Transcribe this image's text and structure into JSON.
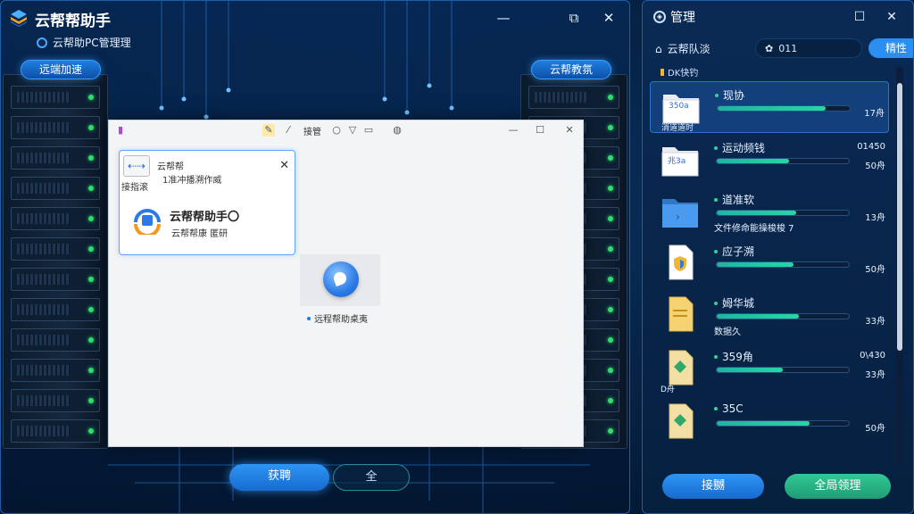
{
  "app": {
    "title": "云帮帮助手",
    "subtitle": "云帮助PC管理理"
  },
  "window_controls": {
    "minimize": "—",
    "restore": "⧉",
    "close": "✕"
  },
  "pills": {
    "left": "远端加速",
    "right": "云帮教氛"
  },
  "inner_window": {
    "toolbar": {
      "label": "接管"
    },
    "controls": {
      "minimize": "—",
      "maximize": "☐",
      "close": "✕"
    },
    "card": {
      "icon_label": "接指滚",
      "title": "云帮帮",
      "desc": "1准冲播溯作威",
      "app_name": "云帮帮助手〇",
      "app_sub": "云帮帮康 匿研"
    },
    "file_label": "远程帮助桌夷"
  },
  "bottom_buttons": {
    "primary": "获聘",
    "secondary": "全"
  },
  "side": {
    "title": "管理",
    "controls": {
      "pin": "☐",
      "close": "✕"
    },
    "seg_label": "云帮队淡",
    "seg_pill": "011",
    "seg_active": "精性",
    "list_header": "DK快钓",
    "items": [
      {
        "name": "现协",
        "thumb_label": "350a",
        "thumb_sub": "消道道时",
        "right": "17舟",
        "top_right": "",
        "sub": "",
        "progress": 0.82,
        "type": "folder",
        "selected": true
      },
      {
        "name": "运动频钱",
        "thumb_label": "兆3a",
        "thumb_sub": "",
        "right": "50舟",
        "top_right": "01450",
        "sub": "",
        "progress": 0.55,
        "type": "folder",
        "selected": false
      },
      {
        "name": "道准软",
        "thumb_label": "",
        "thumb_sub": "",
        "right": "13舟",
        "top_right": "",
        "sub": "文件修命能操梭梭 7",
        "progress": 0.6,
        "type": "folder-blue",
        "selected": false
      },
      {
        "name": "应子溯",
        "thumb_label": "",
        "thumb_sub": "",
        "right": "50舟",
        "top_right": "",
        "sub": "",
        "progress": 0.58,
        "type": "doc-shield",
        "selected": false
      },
      {
        "name": "姆华城",
        "thumb_label": "",
        "thumb_sub": "",
        "right": "33舟",
        "top_right": "",
        "sub": "数据久",
        "progress": 0.62,
        "type": "doc-yellow",
        "selected": false
      },
      {
        "name": "359角",
        "thumb_label": "",
        "thumb_sub": "D舟",
        "right": "33舟",
        "top_right": "0\\430",
        "sub": "",
        "progress": 0.5,
        "type": "doc-diamond",
        "selected": false
      },
      {
        "name": "35C",
        "thumb_label": "",
        "thumb_sub": "",
        "right": "50舟",
        "top_right": "",
        "sub": "",
        "progress": 0.7,
        "type": "doc-diamond",
        "selected": false
      }
    ],
    "buttons": {
      "left": "接嬲",
      "right": "全局领理"
    }
  },
  "colors": {
    "accent": "#2a8ff0",
    "progress": "#27d6a6",
    "green_button": "#2bb88a"
  }
}
